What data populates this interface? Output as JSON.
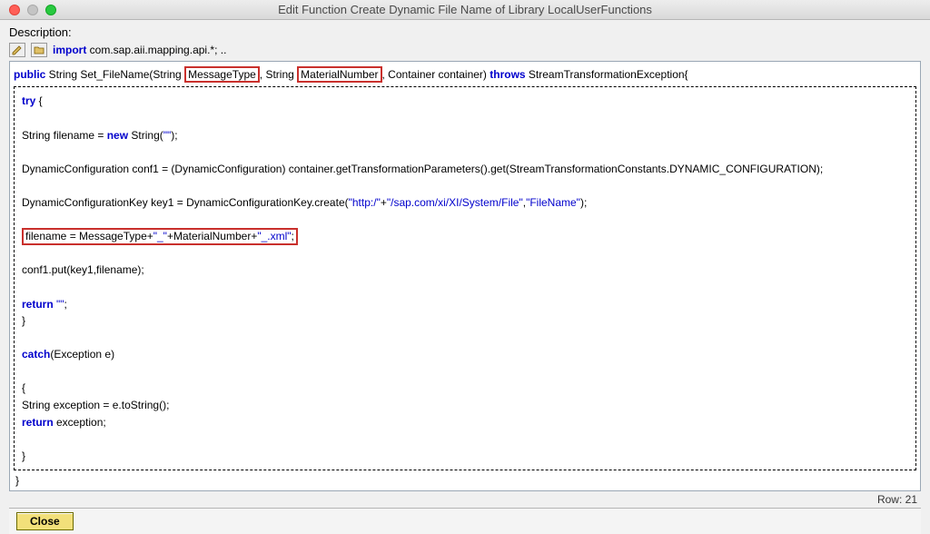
{
  "window": {
    "title": "Edit Function Create Dynamic File Name of Library LocalUserFunctions"
  },
  "labels": {
    "description": "Description:",
    "row_status": "Row: 21",
    "close": "Close"
  },
  "toolbar": {
    "import_kw": "import",
    "import_text": " com.sap.aii.mapping.api.*; .."
  },
  "signature": {
    "public_kw": "public",
    "ret_fn": " String Set_FileName(String ",
    "param1": "MessageType",
    "mid1": ", String ",
    "param2": "MaterialNumber",
    "mid2": ", Container container) ",
    "throws_kw": "throws",
    "tail": " StreamTransformationException{"
  },
  "code": {
    "l1_kw": "try",
    "l1_txt": " {",
    "blank": "",
    "l2a": "String filename = ",
    "l2_kw": "new",
    "l2b": " String(",
    "l2_str": "\"\"",
    "l2c": ");",
    "l3": "DynamicConfiguration conf1 = (DynamicConfiguration) container.getTransformationParameters().get(StreamTransformationConstants.DYNAMIC_CONFIGURATION);",
    "l4a": "DynamicConfigurationKey key1 = DynamicConfigurationKey.create(",
    "l4_str1": "\"http:/\"",
    "l4_plus1": "+",
    "l4_str2": "\"/sap.com/xi/XI/System/File\"",
    "l4_comma": ",",
    "l4_str3": "\"FileName\"",
    "l4_end": ");",
    "l5a": "filename = MessageType+",
    "l5_str1": "\"_\"",
    "l5b": "+MaterialNumber+",
    "l5_str2": "\"_.xml\"",
    "l5c": ";",
    "l6": "conf1.put(key1,filename);",
    "l7_kw": "return",
    "l7_str": " \"\"",
    "l7_end": ";",
    "l8": "}",
    "l9_kw": "catch",
    "l9_txt": "(Exception e)",
    "l10": "{",
    "l11": "String exception = e.toString();",
    "l12_kw": "return",
    "l12_txt": " exception;",
    "l13": "}",
    "close": "}"
  }
}
